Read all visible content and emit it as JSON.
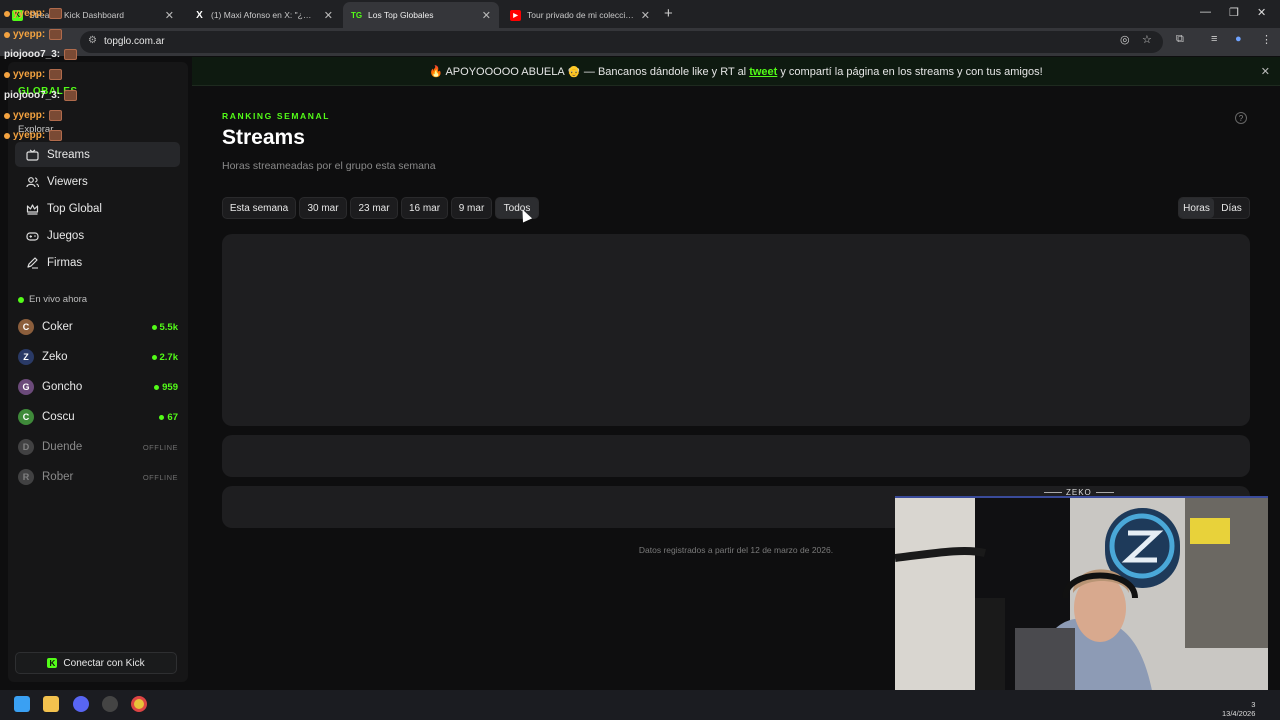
{
  "browser": {
    "tabs": [
      {
        "title": "Stream - Kick Dashboard",
        "favicon": "kick-icon",
        "active": false
      },
      {
        "title": "(1) Maxi Afonso en X: \"¿Qué pu",
        "favicon": "x-icon",
        "active": false
      },
      {
        "title": "Los Top Globales",
        "favicon": "TG",
        "active": true
      },
      {
        "title": "Tour privado de mi colección de",
        "favicon": "youtube-icon",
        "active": false
      }
    ],
    "url": "topglo.com.ar"
  },
  "banner": {
    "before": "🔥 APOYOOOOO ABUELA 👴 — Bancanos dándole like y RT al ",
    "link": "tweet",
    "after": " y compartí la página en los streams y con tus amigos!"
  },
  "chat_overlay": [
    {
      "user": "yyepp:"
    },
    {
      "user": "yyepp:"
    },
    {
      "user": "piojooo7_3:"
    },
    {
      "user": "yyepp:"
    },
    {
      "user": "piojooo7_3:"
    },
    {
      "user": "yyepp:"
    },
    {
      "user": "yyepp:"
    }
  ],
  "sidebar": {
    "ghost_labels": [
      "GLOBALES",
      "Explorar"
    ],
    "nav": [
      {
        "label": "Streams",
        "icon": "tv-icon",
        "active": true
      },
      {
        "label": "Viewers",
        "icon": "users-icon",
        "active": false
      },
      {
        "label": "Top Global",
        "icon": "crown-icon",
        "active": false
      },
      {
        "label": "Juegos",
        "icon": "gamepad-icon",
        "active": false
      },
      {
        "label": "Firmas",
        "icon": "pen-icon",
        "active": false
      }
    ],
    "live_heading": "En vivo ahora",
    "streamers": [
      {
        "name": "Coker",
        "viewers": "5.5k",
        "online": true,
        "color": "#8b5e3c"
      },
      {
        "name": "Zeko",
        "viewers": "2.7k",
        "online": true,
        "color": "#2a3a66"
      },
      {
        "name": "Goncho",
        "viewers": "959",
        "online": true,
        "color": "#6b4a7a"
      },
      {
        "name": "Coscu",
        "viewers": "67",
        "online": true,
        "color": "#3f8a3a"
      },
      {
        "name": "Duende",
        "viewers": "OFFLINE",
        "online": false,
        "color": "#777777"
      },
      {
        "name": "Rober",
        "viewers": "OFFLINE",
        "online": false,
        "color": "#777777"
      }
    ],
    "connect_label": "Conectar con Kick"
  },
  "main": {
    "kicker": "RANKING SEMANAL",
    "title": "Streams",
    "subtitle": "Horas streameadas por el grupo esta semana",
    "filters": [
      "Esta semana",
      "30 mar",
      "23 mar",
      "16 mar",
      "9 mar",
      "Todos"
    ],
    "selected_filter": "Todos",
    "units": [
      "Horas",
      "Días"
    ],
    "selected_unit": "Horas",
    "footnote": "Datos registrados a partir del 12 de marzo de 2026."
  },
  "webcam": {
    "label": "ZEKO"
  },
  "taskbar": {
    "time": "3",
    "date": "13/4/2026"
  },
  "colors": {
    "accent": "#53fc18",
    "background": "#0e0e0f",
    "panel": "#1e1e20"
  }
}
